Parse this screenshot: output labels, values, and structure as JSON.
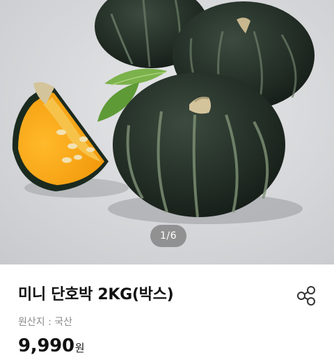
{
  "gallery": {
    "image_alt": "mini sweet pumpkins product photo",
    "page_indicator": "1/6"
  },
  "product": {
    "title": "미니 단호박 2KG(박스)",
    "origin": "원산지 : 국산",
    "price": "9,990",
    "price_unit": "원"
  },
  "actions": {
    "share_icon": "share-icon"
  },
  "colors": {
    "price_text": "#111111",
    "muted_text": "#8a8a8a",
    "indicator_bg": "#5a5a5a"
  }
}
